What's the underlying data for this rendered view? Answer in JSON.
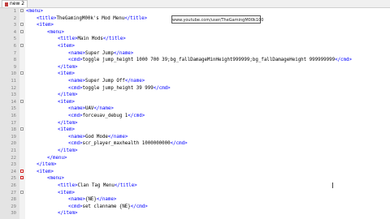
{
  "tab": {
    "label": "new 2"
  },
  "overlay": {
    "url_text": "www.youtube.com/user/TheGamingM00k100"
  },
  "lines": [
    {
      "n": "1",
      "indent": 0,
      "fold": "minus",
      "open": "<menu>",
      "text": "",
      "close": ""
    },
    {
      "n": "2",
      "indent": 1,
      "fold": "",
      "open": "<title>",
      "text": "TheGamingM00k's Mod Menu",
      "close": "</title>"
    },
    {
      "n": "3",
      "indent": 1,
      "fold": "minus",
      "open": "<item>",
      "text": "",
      "close": ""
    },
    {
      "n": "4",
      "indent": 2,
      "fold": "minus",
      "open": "<menu>",
      "text": "",
      "close": ""
    },
    {
      "n": "5",
      "indent": 3,
      "fold": "",
      "open": "<title>",
      "text": "Main Mods",
      "close": "</title>"
    },
    {
      "n": "6",
      "indent": 3,
      "fold": "minus",
      "open": "<item>",
      "text": "",
      "close": ""
    },
    {
      "n": "7",
      "indent": 4,
      "fold": "",
      "open": "<name>",
      "text": "Super Jump",
      "close": "</name>"
    },
    {
      "n": "8",
      "indent": 4,
      "fold": "",
      "open": "<cmd>",
      "text": "toggle jump_height 1000 700 39;bg_fallDamageMinHeight999999;bg_fallDamageHeight 999999999",
      "close": "</cmd>"
    },
    {
      "n": "9",
      "indent": 3,
      "fold": "",
      "open": "</item>",
      "text": "",
      "close": ""
    },
    {
      "n": "10",
      "indent": 3,
      "fold": "minus",
      "open": "<item>",
      "text": "",
      "close": ""
    },
    {
      "n": "11",
      "indent": 4,
      "fold": "",
      "open": "<name>",
      "text": "Super Jump Off",
      "close": "</name>"
    },
    {
      "n": "12",
      "indent": 4,
      "fold": "",
      "open": "<cmd>",
      "text": "toggle jump_height 39 999",
      "close": "</cmd>"
    },
    {
      "n": "13",
      "indent": 3,
      "fold": "",
      "open": "</item>",
      "text": "",
      "close": ""
    },
    {
      "n": "14",
      "indent": 3,
      "fold": "minus",
      "open": "<item>",
      "text": "",
      "close": ""
    },
    {
      "n": "15",
      "indent": 4,
      "fold": "",
      "open": "<name>",
      "text": "UAV",
      "close": "</name>"
    },
    {
      "n": "16",
      "indent": 4,
      "fold": "",
      "open": "<cmd>",
      "text": "forceuav_debug 1",
      "close": "</cmd>"
    },
    {
      "n": "17",
      "indent": 3,
      "fold": "",
      "open": "</item>",
      "text": "",
      "close": ""
    },
    {
      "n": "18",
      "indent": 3,
      "fold": "minus",
      "open": "<item>",
      "text": "",
      "close": ""
    },
    {
      "n": "19",
      "indent": 4,
      "fold": "",
      "open": "<name>",
      "text": "God Mode",
      "close": "</name>"
    },
    {
      "n": "20",
      "indent": 4,
      "fold": "",
      "open": "<cmd>",
      "text": "scr_player_maxhealth 1000000000",
      "close": "</cmd>"
    },
    {
      "n": "21",
      "indent": 3,
      "fold": "",
      "open": "</item>",
      "text": "",
      "close": ""
    },
    {
      "n": "22",
      "indent": 2,
      "fold": "",
      "open": "</menu>",
      "text": "",
      "close": ""
    },
    {
      "n": "23",
      "indent": 1,
      "fold": "",
      "open": "</item>",
      "text": "",
      "close": ""
    },
    {
      "n": "24",
      "indent": 1,
      "fold": "minus",
      "open": "<item>",
      "text": "",
      "close": ""
    },
    {
      "n": "25",
      "indent": 2,
      "fold": "minus",
      "open": "<menu>",
      "text": "",
      "close": ""
    },
    {
      "n": "26",
      "indent": 3,
      "fold": "",
      "open": "<title>",
      "text": "Clan Tag Menu",
      "close": "</title>"
    },
    {
      "n": "27",
      "indent": 3,
      "fold": "minus",
      "open": "<item>",
      "text": "",
      "close": ""
    },
    {
      "n": "28",
      "indent": 4,
      "fold": "",
      "open": "<name>",
      "text": "{NE}",
      "close": "</name>"
    },
    {
      "n": "29",
      "indent": 4,
      "fold": "",
      "open": "<cmd>",
      "text": "set clanname {NE}",
      "close": "</cmd>"
    },
    {
      "n": "30",
      "indent": 3,
      "fold": "",
      "open": "</item>",
      "text": "",
      "close": ""
    }
  ]
}
